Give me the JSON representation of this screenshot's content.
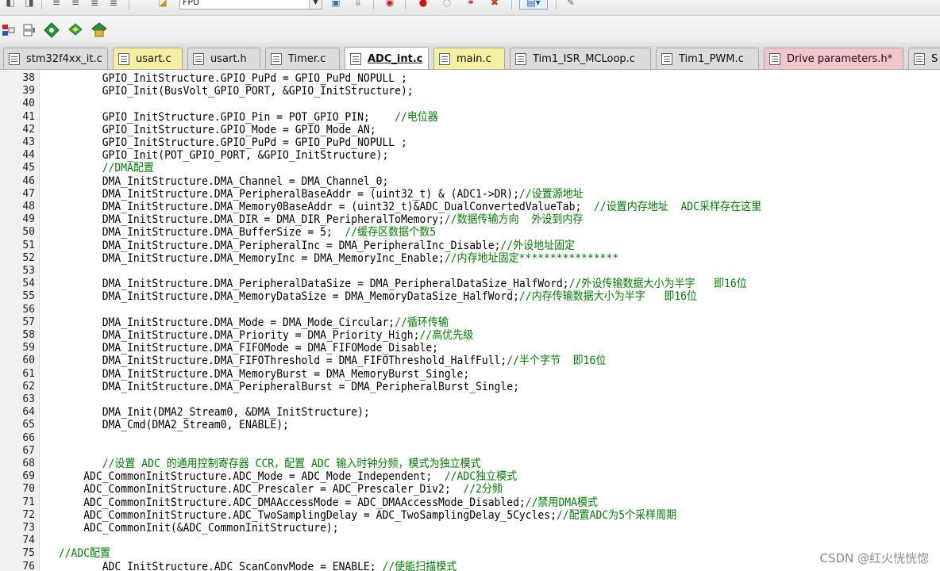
{
  "toolbar": {
    "target_value": "FPU"
  },
  "tabs": [
    {
      "label": "stm32f4xx_it.c",
      "color": "#dcdcdc"
    },
    {
      "label": "usart.c",
      "color": "#f5f0a0"
    },
    {
      "label": "usart.h",
      "color": "#dcdcdc"
    },
    {
      "label": "Timer.c",
      "color": "#dcdcdc"
    },
    {
      "label": "ADC_int.c",
      "color": "#ffffff",
      "active": true
    },
    {
      "label": "main.c",
      "color": "#f5f0a0"
    },
    {
      "label": "Tim1_ISR_MCLoop.c",
      "color": "#dcdcdc"
    },
    {
      "label": "Tim1_PWM.c",
      "color": "#dcdcdc"
    },
    {
      "label": "Drive parameters.h*",
      "color": "#f4c6cc"
    },
    {
      "label": "S",
      "color": "#dcdcdc"
    }
  ],
  "editor": {
    "lines": [
      {
        "n": "38",
        "code": "        GPIO_InitStructure.GPIO_PuPd = GPIO_PuPd_NOPULL ;",
        "comment": ""
      },
      {
        "n": "39",
        "code": "        GPIO_Init(BusVolt_GPIO_PORT, &GPIO_InitStructure);",
        "comment": ""
      },
      {
        "n": "40",
        "code": "",
        "comment": ""
      },
      {
        "n": "41",
        "code": "        GPIO_InitStructure.GPIO_Pin = POT_GPIO_PIN;    ",
        "comment": "//电位器"
      },
      {
        "n": "42",
        "code": "        GPIO_InitStructure.GPIO_Mode = GPIO_Mode_AN;",
        "comment": ""
      },
      {
        "n": "43",
        "code": "        GPIO_InitStructure.GPIO_PuPd = GPIO_PuPd_NOPULL ;",
        "comment": ""
      },
      {
        "n": "44",
        "code": "        GPIO_Init(POT_GPIO_PORT, &GPIO_InitStructure);",
        "comment": ""
      },
      {
        "n": "45",
        "code": "        ",
        "comment": "//DMA配置"
      },
      {
        "n": "46",
        "code": "        DMA_InitStructure.DMA_Channel = DMA_Channel_0;",
        "comment": ""
      },
      {
        "n": "47",
        "code": "        DMA_InitStructure.DMA_PeripheralBaseAddr = (uint32_t) & (ADC1->DR);",
        "comment": "//设置源地址"
      },
      {
        "n": "48",
        "code": "        DMA_InitStructure.DMA_Memory0BaseAddr = (uint32_t)&ADC_DualConvertedValueTab;  ",
        "comment": "//设置内存地址  ADC采样存在这里"
      },
      {
        "n": "49",
        "code": "        DMA_InitStructure.DMA_DIR = DMA_DIR_PeripheralToMemory;",
        "comment": "//数据传输方向  外设到内存"
      },
      {
        "n": "50",
        "code": "        DMA_InitStructure.DMA_BufferSize = 5;  ",
        "comment": "//缓存区数据个数5"
      },
      {
        "n": "51",
        "code": "        DMA_InitStructure.DMA_PeripheralInc = DMA_PeripheralInc_Disable;",
        "comment": "//外设地址固定"
      },
      {
        "n": "52",
        "code": "        DMA_InitStructure.DMA_MemoryInc = DMA_MemoryInc_Enable;",
        "comment": "//内存地址固定****************"
      },
      {
        "n": "53",
        "code": "",
        "comment": ""
      },
      {
        "n": "54",
        "code": "        DMA_InitStructure.DMA_PeripheralDataSize = DMA_PeripheralDataSize_HalfWord;",
        "comment": "//外设传输数据大小为半字   即16位"
      },
      {
        "n": "55",
        "code": "        DMA_InitStructure.DMA_MemoryDataSize = DMA_MemoryDataSize_HalfWord;",
        "comment": "//内存传输数据大小为半字   即16位"
      },
      {
        "n": "56",
        "code": "",
        "comment": ""
      },
      {
        "n": "57",
        "code": "        DMA_InitStructure.DMA_Mode = DMA_Mode_Circular;",
        "comment": "//循环传输"
      },
      {
        "n": "58",
        "code": "        DMA_InitStructure.DMA_Priority = DMA_Priority_High;",
        "comment": "//高优先级"
      },
      {
        "n": "59",
        "code": "        DMA_InitStructure.DMA_FIFOMode = DMA_FIFOMode_Disable;",
        "comment": ""
      },
      {
        "n": "60",
        "code": "        DMA_InitStructure.DMA_FIFOThreshold = DMA_FIFOThreshold_HalfFull;",
        "comment": "//半个字节  即16位"
      },
      {
        "n": "61",
        "code": "        DMA_InitStructure.DMA_MemoryBurst = DMA_MemoryBurst_Single;",
        "comment": ""
      },
      {
        "n": "62",
        "code": "        DMA_InitStructure.DMA_PeripheralBurst = DMA_PeripheralBurst_Single;",
        "comment": ""
      },
      {
        "n": "63",
        "code": "",
        "comment": ""
      },
      {
        "n": "64",
        "code": "        DMA_Init(DMA2_Stream0, &DMA_InitStructure);",
        "comment": ""
      },
      {
        "n": "65",
        "code": "        DMA_Cmd(DMA2_Stream0, ENABLE);",
        "comment": ""
      },
      {
        "n": "66",
        "code": "",
        "comment": ""
      },
      {
        "n": "67",
        "code": "",
        "comment": ""
      },
      {
        "n": "68",
        "code": "        ",
        "comment": "//设置 ADC 的通用控制寄存器 CCR，配置 ADC 输入时钟分频，模式为独立模式"
      },
      {
        "n": "69",
        "code": "     ADC_CommonInitStructure.ADC_Mode = ADC_Mode_Independent;  ",
        "comment": "//ADC独立模式"
      },
      {
        "n": "70",
        "code": "     ADC_CommonInitStructure.ADC_Prescaler = ADC_Prescaler_Div2;  ",
        "comment": "//2分频"
      },
      {
        "n": "71",
        "code": "     ADC_CommonInitStructure.ADC_DMAAccessMode = ADC_DMAAccessMode_Disabled;",
        "comment": "//禁用DMA模式"
      },
      {
        "n": "72",
        "code": "     ADC_CommonInitStructure.ADC_TwoSamplingDelay = ADC_TwoSamplingDelay_5Cycles;",
        "comment": "//配置ADC为5个采样周期"
      },
      {
        "n": "73",
        "code": "     ADC_CommonInit(&ADC_CommonInitStructure);",
        "comment": ""
      },
      {
        "n": "74",
        "code": "",
        "comment": ""
      },
      {
        "n": "75",
        "code": " ",
        "comment": "//ADC配置"
      },
      {
        "n": "76",
        "code": "        ADC_InitStructure.ADC_ScanConvMode = ENABLE; ",
        "comment": "//使能扫描模式"
      }
    ]
  },
  "watermark": "CSDN @红火恍恍惚"
}
